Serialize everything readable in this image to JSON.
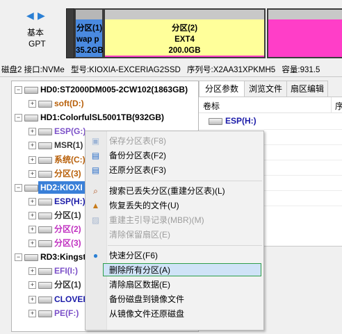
{
  "disk_style": {
    "title": "基本",
    "subtitle": "GPT"
  },
  "partitions": [
    {
      "name": "分区(1)",
      "fs": "wap p",
      "size": "35.2GB"
    },
    {
      "name": "分区(2)",
      "fs": "EXT4",
      "size": "200.0GB"
    }
  ],
  "disk_info": {
    "disk": "磁盘2 接口:NVMe",
    "model": "型号:KIOXIA-EXCERIAG2SSD",
    "serial": "序列号:X2AA31XPKMH5",
    "capacity": "容量:931.5"
  },
  "tree": [
    {
      "label": "HD0:ST2000DM005-2CW102(1863GB)",
      "kind": "disk",
      "color": "#000000"
    },
    {
      "label": "soft(D:)",
      "kind": "part",
      "color": "#b8600a"
    },
    {
      "label": "HD1:ColorfulSL5001TB(932GB)",
      "kind": "disk",
      "color": "#000000"
    },
    {
      "label": "ESP(G:)",
      "kind": "part",
      "color": "#7b4fc8"
    },
    {
      "label": "MSR(1)",
      "kind": "part",
      "color": "#333333"
    },
    {
      "label": "系统(C:)",
      "kind": "part",
      "color": "#b8600a"
    },
    {
      "label": "分区(3)",
      "kind": "part",
      "color": "#b8600a"
    },
    {
      "label": "HD2:KIOXI",
      "kind": "disk",
      "color": "#ffffff"
    },
    {
      "label": "ESP(H:)",
      "kind": "part",
      "color": "#1a1aa8"
    },
    {
      "label": "分区(1)",
      "kind": "part",
      "color": "#333333"
    },
    {
      "label": "分区(2)",
      "kind": "part",
      "color": "#c030c0"
    },
    {
      "label": "分区(3)",
      "kind": "part",
      "color": "#c030c0"
    },
    {
      "label": "RD3:Kingst",
      "kind": "disk",
      "color": "#000000"
    },
    {
      "label": "EFI(I:)",
      "kind": "part",
      "color": "#7b4fc8"
    },
    {
      "label": "分区(1)",
      "kind": "part",
      "color": "#333333"
    },
    {
      "label": "CLOVER",
      "kind": "part",
      "color": "#1a1aa8"
    },
    {
      "label": "PE(F:)",
      "kind": "part",
      "color": "#7b4fc8"
    }
  ],
  "tabs": [
    "分区参数",
    "浏览文件",
    "扇区编辑"
  ],
  "columns": {
    "label": "卷标",
    "next": "序"
  },
  "right_row": {
    "label": "ESP(H:)"
  },
  "menu": [
    {
      "label": "保存分区表(F8)",
      "icon": "save-icon",
      "disabled": true
    },
    {
      "label": "备份分区表(F2)",
      "icon": "backup-icon",
      "disabled": false
    },
    {
      "label": "还原分区表(F3)",
      "icon": "restore-icon",
      "disabled": false
    },
    {
      "sep": true
    },
    {
      "label": "搜索已丢失分区(重建分区表)(L)",
      "icon": "search-icon",
      "disabled": false
    },
    {
      "label": "恢复丢失的文件(U)",
      "icon": "recover-icon",
      "disabled": false
    },
    {
      "label": "重建主引导记录(MBR)(M)",
      "icon": "mbr-icon",
      "disabled": true
    },
    {
      "label": "清除保留扇区(E)",
      "icon": "",
      "disabled": true
    },
    {
      "sep": true
    },
    {
      "label": "快速分区(F6)",
      "icon": "quick-partition-icon",
      "disabled": false
    },
    {
      "label": "删除所有分区(A)",
      "icon": "",
      "disabled": false,
      "highlighted": true
    },
    {
      "label": "清除扇区数据(E)",
      "icon": "",
      "disabled": false
    },
    {
      "label": "备份磁盘到镜像文件",
      "icon": "",
      "disabled": false
    },
    {
      "label": "从镜像文件还原磁盘",
      "icon": "",
      "disabled": false
    }
  ],
  "colors": {
    "accent": "#2f7fd6",
    "partition_pink": "#ff3ec8",
    "partition_blue": "#4a8ae0",
    "highlight_border": "#2e9e4a"
  }
}
